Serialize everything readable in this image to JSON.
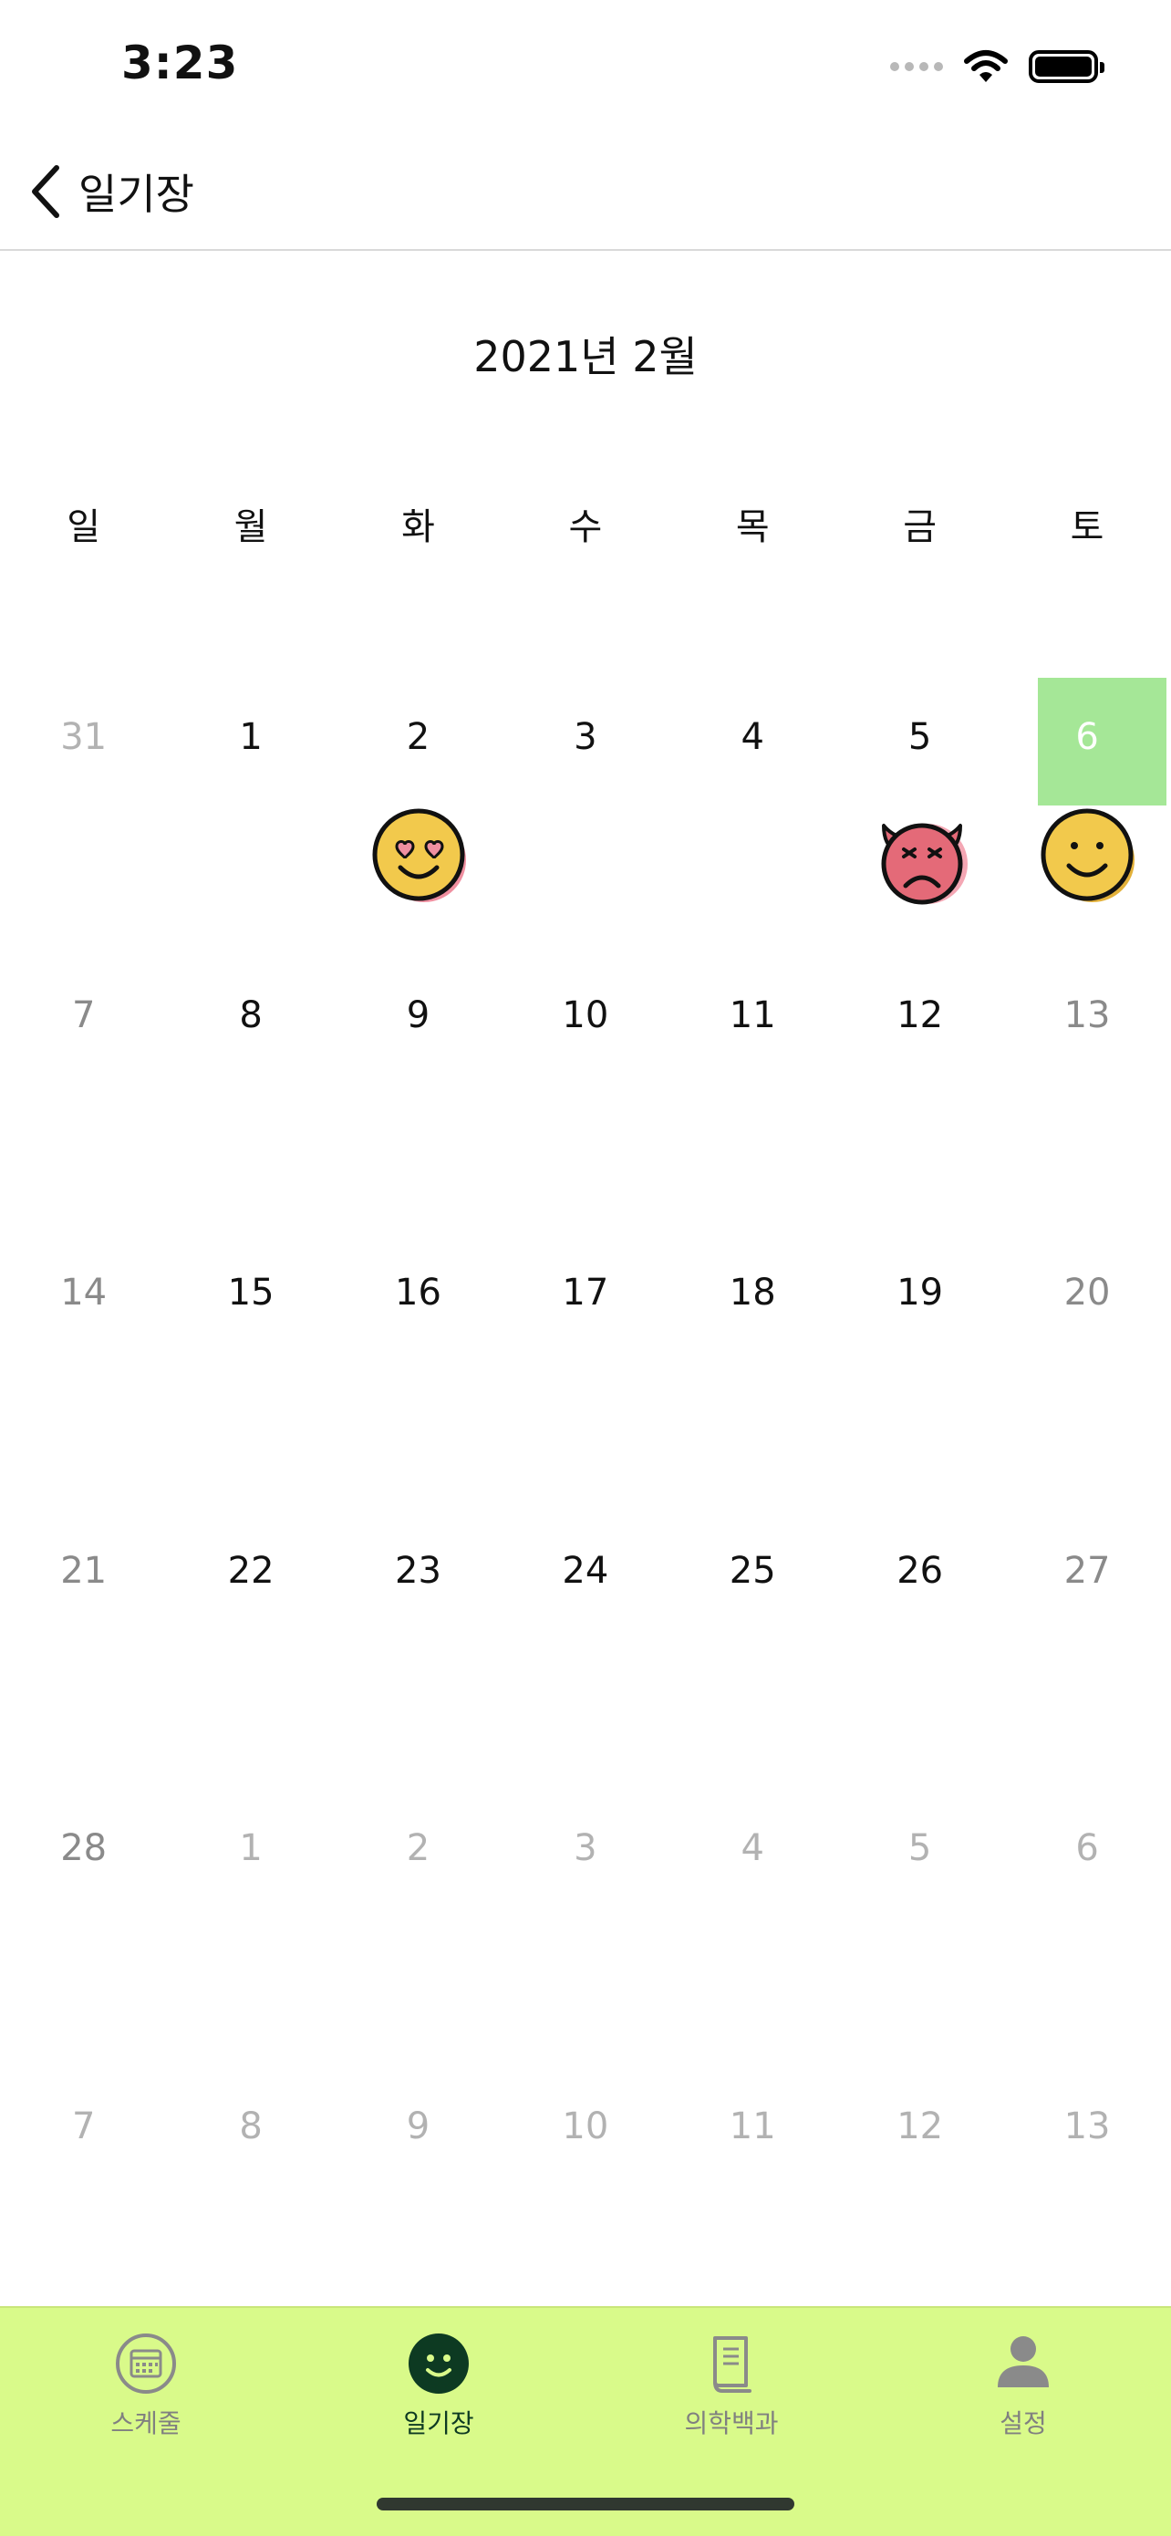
{
  "status_bar": {
    "time": "3:23"
  },
  "nav": {
    "back_label": "일기장"
  },
  "calendar": {
    "month_title": "2021년 2월",
    "weekdays": [
      "일",
      "월",
      "화",
      "수",
      "목",
      "금",
      "토"
    ],
    "weeks": [
      [
        {
          "day": "31",
          "style": "muted"
        },
        {
          "day": "1",
          "style": "normal"
        },
        {
          "day": "2",
          "style": "normal",
          "mood": "heart-eyes-emoji-icon"
        },
        {
          "day": "3",
          "style": "normal"
        },
        {
          "day": "4",
          "style": "normal"
        },
        {
          "day": "5",
          "style": "normal",
          "mood": "angry-devil-emoji-icon"
        },
        {
          "day": "6",
          "style": "selected",
          "mood": "smile-emoji-icon"
        }
      ],
      [
        {
          "day": "7",
          "style": "weekend"
        },
        {
          "day": "8",
          "style": "normal"
        },
        {
          "day": "9",
          "style": "normal"
        },
        {
          "day": "10",
          "style": "normal"
        },
        {
          "day": "11",
          "style": "normal"
        },
        {
          "day": "12",
          "style": "normal"
        },
        {
          "day": "13",
          "style": "weekend"
        }
      ],
      [
        {
          "day": "14",
          "style": "weekend"
        },
        {
          "day": "15",
          "style": "normal"
        },
        {
          "day": "16",
          "style": "normal"
        },
        {
          "day": "17",
          "style": "normal"
        },
        {
          "day": "18",
          "style": "normal"
        },
        {
          "day": "19",
          "style": "normal"
        },
        {
          "day": "20",
          "style": "weekend"
        }
      ],
      [
        {
          "day": "21",
          "style": "weekend"
        },
        {
          "day": "22",
          "style": "normal"
        },
        {
          "day": "23",
          "style": "normal"
        },
        {
          "day": "24",
          "style": "normal"
        },
        {
          "day": "25",
          "style": "normal"
        },
        {
          "day": "26",
          "style": "normal"
        },
        {
          "day": "27",
          "style": "weekend"
        }
      ],
      [
        {
          "day": "28",
          "style": "weekend"
        },
        {
          "day": "1",
          "style": "muted"
        },
        {
          "day": "2",
          "style": "muted"
        },
        {
          "day": "3",
          "style": "muted"
        },
        {
          "day": "4",
          "style": "muted"
        },
        {
          "day": "5",
          "style": "muted"
        },
        {
          "day": "6",
          "style": "muted"
        }
      ],
      [
        {
          "day": "7",
          "style": "muted"
        },
        {
          "day": "8",
          "style": "muted"
        },
        {
          "day": "9",
          "style": "muted"
        },
        {
          "day": "10",
          "style": "muted"
        },
        {
          "day": "11",
          "style": "muted"
        },
        {
          "day": "12",
          "style": "muted"
        },
        {
          "day": "13",
          "style": "muted"
        }
      ]
    ]
  },
  "tab_bar": {
    "tabs": [
      {
        "label": "스케줄",
        "icon": "calendar-icon",
        "active": false
      },
      {
        "label": "일기장",
        "icon": "smile-icon",
        "active": true
      },
      {
        "label": "의학백과",
        "icon": "book-icon",
        "active": false
      },
      {
        "label": "설정",
        "icon": "person-icon",
        "active": false
      }
    ]
  },
  "colors": {
    "selected_day": "#a5e797",
    "tab_bar_bg": "#d9fa8a",
    "active_tab": "#0d3a22",
    "inactive_tab": "#808080"
  }
}
